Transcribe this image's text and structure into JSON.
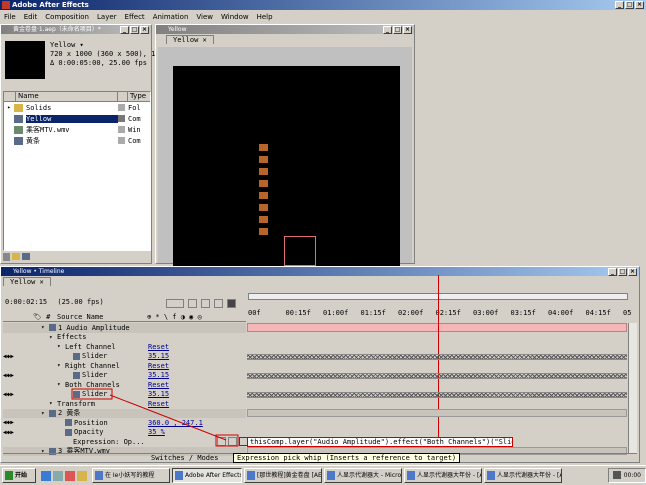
{
  "app": {
    "title": "Adobe After Effects",
    "menu": [
      "File",
      "Edit",
      "Composition",
      "Layer",
      "Effect",
      "Animation",
      "View",
      "Window",
      "Help"
    ]
  },
  "project": {
    "window_title": "黄金卷盘·1.aep（未命名项目）*",
    "comp_name": "Yellow ▾",
    "comp_size": "720 x 1000  (360 x 500), 1",
    "comp_duration": "Δ 0:00:05:00, 25.00 fps",
    "columns": {
      "name": "Name",
      "type": "Type"
    },
    "items": [
      {
        "name": "Solids",
        "type": "Fol",
        "kind": "folder"
      },
      {
        "name": "Yellow",
        "type": "Com",
        "kind": "comp",
        "selected": true
      },
      {
        "name": "乘客MTV.wmv",
        "type": "Win",
        "kind": "video"
      },
      {
        "name": "黄条",
        "type": "Com",
        "kind": "comp"
      }
    ]
  },
  "comp_window": {
    "title": "Yellow",
    "tab": "Yellow"
  },
  "timeline": {
    "window_title": "Yellow • Timeline",
    "tab": "Yellow",
    "current_time": "0:00:02:15",
    "fps": "(25.00 fps)",
    "column_header": "Source Name",
    "ruler_ticks": [
      "00f",
      "00:15f",
      "01:00f",
      "01:15f",
      "02:00f",
      "02:15f",
      "03:00f",
      "03:15f",
      "04:00f",
      "04:15f",
      "05"
    ],
    "rows": [
      {
        "indent": 0,
        "label": "1  Audio Amplitude",
        "value": "",
        "type": "layer"
      },
      {
        "indent": 1,
        "label": "Effects",
        "value": "",
        "type": "group"
      },
      {
        "indent": 2,
        "label": "Left Channel",
        "value": "Reset",
        "type": "effect"
      },
      {
        "indent": 3,
        "label": "Slider",
        "value": "35.15",
        "type": "param"
      },
      {
        "indent": 2,
        "label": "Right Channel",
        "value": "Reset",
        "type": "effect"
      },
      {
        "indent": 3,
        "label": "Slider",
        "value": "35.15",
        "type": "param"
      },
      {
        "indent": 2,
        "label": "Both Channels",
        "value": "Reset",
        "type": "effect"
      },
      {
        "indent": 3,
        "label": "Slider",
        "value": "35.15",
        "type": "param"
      },
      {
        "indent": 1,
        "label": "Transform",
        "value": "Reset",
        "type": "group"
      },
      {
        "indent": 0,
        "label": "2  黄条",
        "value": "",
        "type": "layer"
      },
      {
        "indent": 2,
        "label": "Position",
        "value": "360.0 , 247.1",
        "type": "param"
      },
      {
        "indent": 2,
        "label": "Opacity",
        "value": "35 %",
        "type": "param"
      },
      {
        "indent": 3,
        "label": "Expression: Op...",
        "value": "",
        "type": "expr"
      },
      {
        "indent": 0,
        "label": "3  乘客MTV.wmv",
        "value": "",
        "type": "layer"
      }
    ],
    "expression": "thisComp.layer(\"Audio Amplitude\").effect(\"Both Channels\")(\"Slider\")",
    "switches_label": "Switches / Modes",
    "tooltip": "Expression pick whip (Inserts a reference to target)"
  },
  "taskbar": {
    "start": "开始",
    "tasks": [
      "在 Ie小妖写的教程",
      "Adobe After Effects",
      "[那世教程]黄金卷盘 [AE...",
      "人显示代谢器大 - Microsoft ...",
      "人显示代谢器大年份 - [AE...",
      "人显示代谢器大年份 - [AE..."
    ],
    "clock": "00:00"
  },
  "colors": {
    "titlebar": "#0a246a",
    "comp_bg": "#000000",
    "bar_color": "#b8652a",
    "work_area": "#f4b6b6",
    "time_marker": "#cc0000",
    "link_blue": "#00008c"
  }
}
